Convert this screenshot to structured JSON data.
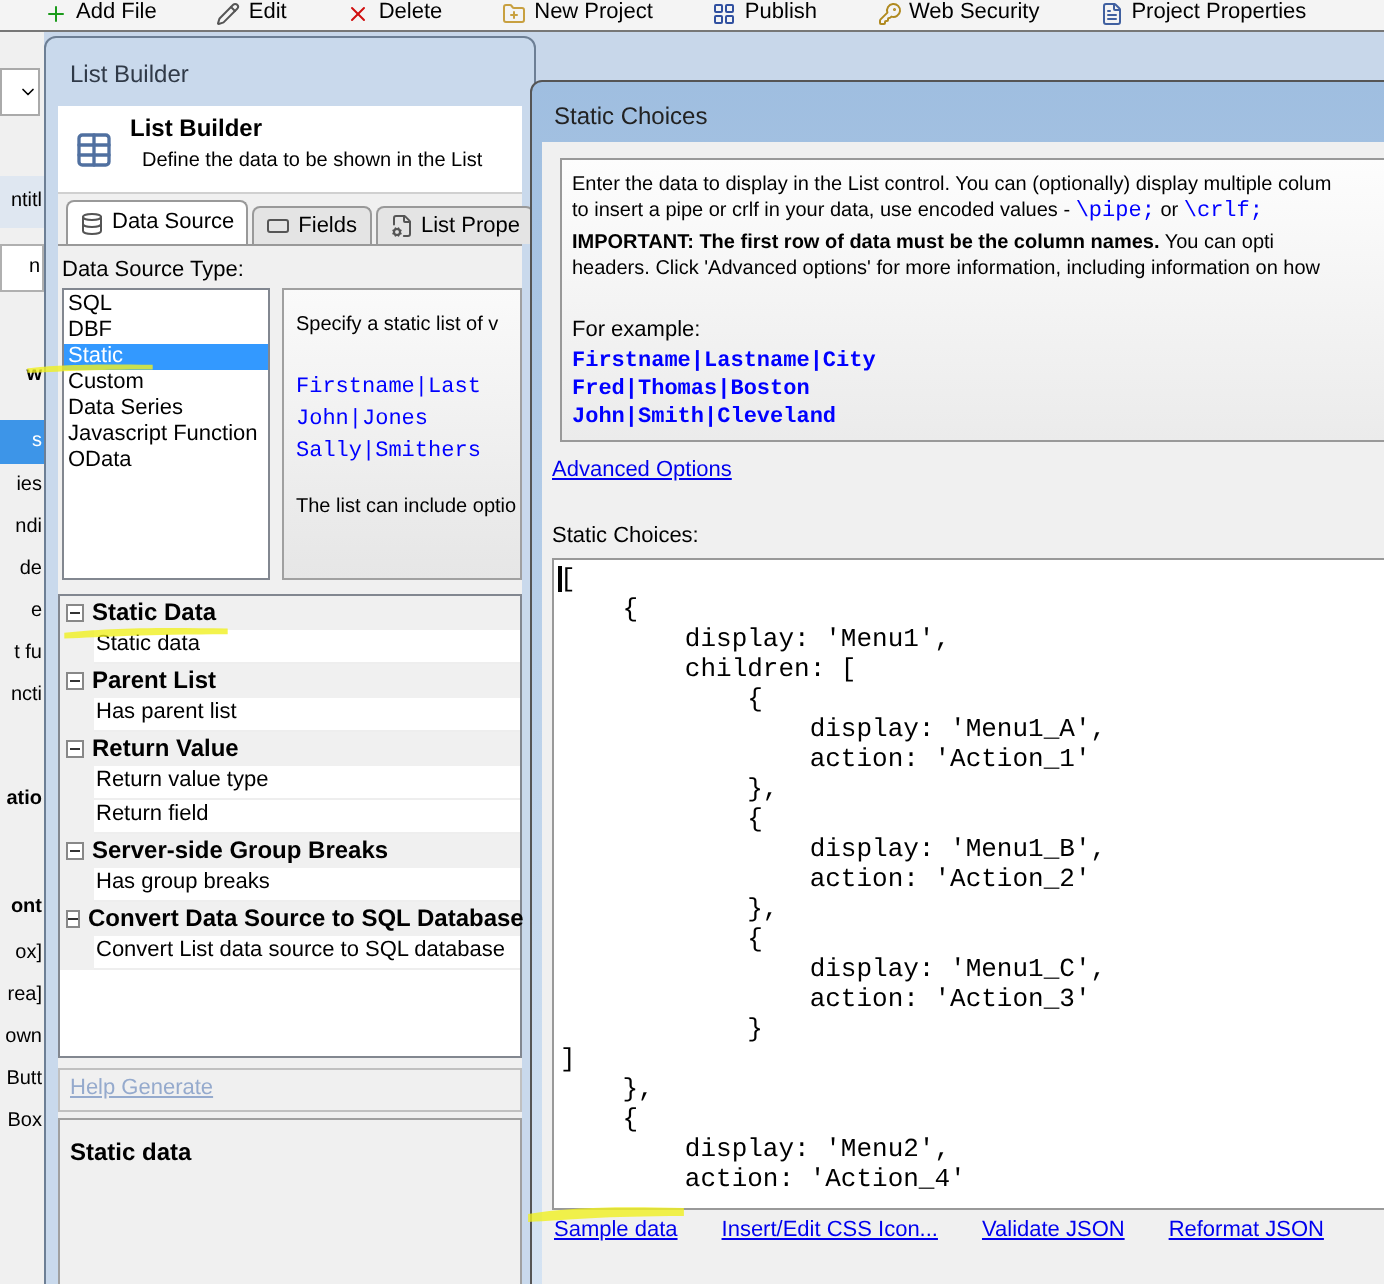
{
  "toolbar": [
    {
      "label": "Add File"
    },
    {
      "label": "Edit"
    },
    {
      "label": "Delete"
    },
    {
      "label": "New Project"
    },
    {
      "label": "Publish"
    },
    {
      "label": "Web Security"
    },
    {
      "label": "Project Properties"
    }
  ],
  "side_strip": [
    {
      "text": "ntitl",
      "kind": "title"
    },
    {
      "text": "n",
      "kind": "tab"
    },
    {
      "text": "w",
      "kind": "heading"
    },
    {
      "text": "s",
      "kind": "selected"
    },
    {
      "text": "ies",
      "kind": "item"
    },
    {
      "text": "ndi",
      "kind": "item"
    },
    {
      "text": "de",
      "kind": "item"
    },
    {
      "text": "e",
      "kind": "item"
    },
    {
      "text": "t fu",
      "kind": "item"
    },
    {
      "text": "ncti",
      "kind": "item"
    },
    {
      "text": "atio",
      "kind": "heading"
    },
    {
      "text": "ont",
      "kind": "heading"
    },
    {
      "text": "ox]",
      "kind": "item"
    },
    {
      "text": "rea]",
      "kind": "item"
    },
    {
      "text": "own",
      "kind": "item"
    },
    {
      "text": "Butt",
      "kind": "item"
    },
    {
      "text": "Box",
      "kind": "item"
    }
  ],
  "list_builder": {
    "title": "List Builder",
    "header_title": "List Builder",
    "header_subtitle": "Define the data to be shown in the List",
    "tabs": [
      {
        "label": "Data Source",
        "selected": true
      },
      {
        "label": "Fields",
        "selected": false
      },
      {
        "label": "List Prope",
        "selected": false
      }
    ],
    "source_type_label": "Data Source Type:",
    "source_types": [
      {
        "label": "SQL",
        "selected": false
      },
      {
        "label": "DBF",
        "selected": false
      },
      {
        "label": "Static",
        "selected": true
      },
      {
        "label": "Custom",
        "selected": false
      },
      {
        "label": "Data Series",
        "selected": false
      },
      {
        "label": "Javascript Function",
        "selected": false
      },
      {
        "label": "OData",
        "selected": false
      }
    ],
    "description": {
      "intro": "Specify a static list of v",
      "example_lines": [
        "Firstname|Last",
        "John|Jones",
        "Sally|Smithers"
      ],
      "note": "The list can include optio"
    },
    "property_sections": [
      {
        "title": "Static Data",
        "expanded": true,
        "items": [
          "Static data"
        ]
      },
      {
        "title": "Parent List",
        "expanded": true,
        "items": [
          "Has parent list"
        ]
      },
      {
        "title": "Return Value",
        "expanded": true,
        "items": [
          "Return value type",
          "Return field"
        ]
      },
      {
        "title": "Server-side Group Breaks",
        "expanded": true,
        "items": [
          "Has group breaks"
        ]
      },
      {
        "title": "Convert Data Source to SQL Database",
        "expanded": true,
        "items": [
          "Convert List data source to SQL database"
        ]
      }
    ],
    "help_link": "Help Generate",
    "help_title": "Static data"
  },
  "static_choices": {
    "title": "Static Choices",
    "info_lines": [
      [
        {
          "text": "Enter the data to display in the List control. You can (optionally) display multiple colum"
        }
      ],
      [
        {
          "text": "to insert a pipe or crlf in your data, use encoded values - "
        },
        {
          "text": "\\pipe;",
          "kind": "code"
        },
        {
          "text": " or "
        },
        {
          "text": "\\crlf;",
          "kind": "code"
        }
      ],
      [
        {
          "text": "**IMPORTANT: The first row of data must be the column names.** You can opti"
        }
      ],
      [
        {
          "text": "headers. Click 'Advanced options' for more information, including information on how"
        }
      ]
    ],
    "example_label": "For example:",
    "example_lines": [
      "Firstname|Lastname|City",
      "Fred|Thomas|Boston",
      "John|Smith|Cleveland"
    ],
    "advanced_link": "Advanced Options",
    "choices_label": "Static Choices:",
    "value": "[\n    {\n        display: 'Menu1',\n        children: [\n            {\n                display: 'Menu1_A',\n                action: 'Action_1'\n            },\n            {\n                display: 'Menu1_B',\n                action: 'Action_2'\n            },\n            {\n                display: 'Menu1_C',\n                action: 'Action_3'\n            }\n]\n    },\n    {\n        display: 'Menu2',\n        action: 'Action_4'",
    "links": [
      "Sample data",
      "Insert/Edit CSS Icon...",
      "Validate JSON",
      "Reformat JSON"
    ]
  }
}
